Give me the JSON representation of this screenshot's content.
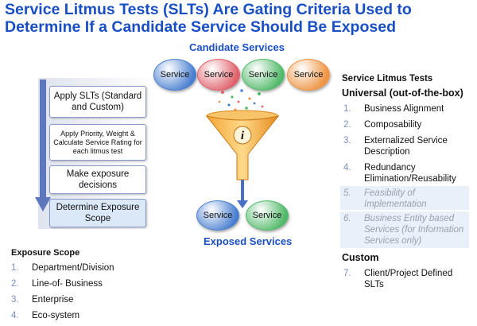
{
  "title": {
    "line1": "Service Litmus Tests (SLTs) Are Gating Criteria Used to",
    "line2": "Determine If a Candidate Service Should Be Exposed"
  },
  "diagram": {
    "candidate_label": "Candidate Services",
    "exposed_label": "Exposed Services",
    "candidate_services": [
      {
        "label": "Service",
        "color": "#4a7fd0"
      },
      {
        "label": "Service",
        "color": "#e0616b"
      },
      {
        "label": "Service",
        "color": "#52b96a"
      },
      {
        "label": "Service",
        "color": "#ef9443"
      }
    ],
    "exposed_services": [
      {
        "label": "Service",
        "color": "#4a7fd0"
      },
      {
        "label": "Service",
        "color": "#52b96a"
      }
    ],
    "funnel_icon": "info-icon"
  },
  "process": {
    "steps": [
      "Apply SLTs (Standard and Custom)",
      "Apply Priority, Weight & Calculate Service Rating for each litmus test",
      "Make exposure decisions",
      "Determine Exposure Scope"
    ]
  },
  "exposure_scope": {
    "heading": "Exposure Scope",
    "items": [
      {
        "num": "1.",
        "text": "Department/Division"
      },
      {
        "num": "2.",
        "text": "Line-of- Business"
      },
      {
        "num": "3.",
        "text": "Enterprise"
      },
      {
        "num": "4.",
        "text": "Eco-system"
      }
    ]
  },
  "litmus_tests": {
    "heading": "Service Litmus Tests",
    "universal_heading": "Universal (out-of-the-box)",
    "universal_items": [
      {
        "num": "1.",
        "text": "Business Alignment",
        "dim": false
      },
      {
        "num": "2.",
        "text": "Composability",
        "dim": false
      },
      {
        "num": "3.",
        "text": "Externalized Service Description",
        "dim": false
      },
      {
        "num": "4.",
        "text": "Redundancy Elimination/Reusability",
        "dim": false
      },
      {
        "num": "5.",
        "text": "Feasibility of Implementation",
        "dim": true
      },
      {
        "num": "6.",
        "text": "Business Entity based Services (for Information Services only)",
        "dim": true
      }
    ],
    "custom_heading": "Custom",
    "custom_items": [
      {
        "num": "7.",
        "text": "Client/Project Defined SLTs",
        "dim": false
      }
    ]
  }
}
